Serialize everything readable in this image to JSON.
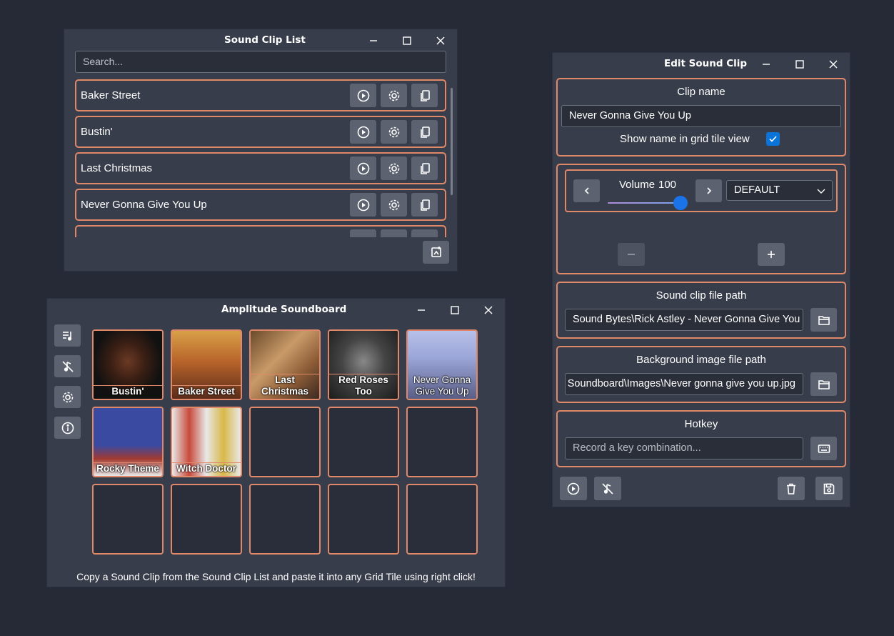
{
  "clip_list_window": {
    "title": "Sound Clip List",
    "search_placeholder": "Search...",
    "clips": [
      {
        "name": "Baker Street"
      },
      {
        "name": "Bustin'"
      },
      {
        "name": "Last Christmas"
      },
      {
        "name": "Never Gonna Give You Up"
      }
    ]
  },
  "soundboard_window": {
    "title": "Amplitude Soundboard",
    "tiles": [
      {
        "label": "Bustin'"
      },
      {
        "label": "Baker Street"
      },
      {
        "label": "Last Christmas"
      },
      {
        "label": "Red Roses Too"
      },
      {
        "label": "Never Gonna Give You Up"
      },
      {
        "label": "Rocky Theme"
      },
      {
        "label": "Witch Doctor"
      }
    ],
    "footer": "Copy a Sound Clip from the Sound Clip List and paste it into any Grid Tile using right click!"
  },
  "edit_window": {
    "title": "Edit Sound Clip",
    "clip_name_title": "Clip name",
    "clip_name_value": "Never Gonna Give You Up",
    "show_name_label": "Show name in grid tile view",
    "show_name_checked": true,
    "volume_label": "Volume",
    "volume_value": "100",
    "output_device": "DEFAULT",
    "file_path_title": "Sound clip file path",
    "file_path_value": "Sound Bytes\\Rick Astley - Never Gonna Give You Up",
    "bg_image_title": "Background image file path",
    "bg_image_value": "Soundboard\\Images\\Never gonna give you up.jpg",
    "hotkey_title": "Hotkey",
    "hotkey_placeholder": "Record a key combination..."
  },
  "colors": {
    "background": "#252a36",
    "window": "#383d4b",
    "accent_border": "#e0896a",
    "button": "#5d6270",
    "checkbox": "#0a74d8"
  }
}
